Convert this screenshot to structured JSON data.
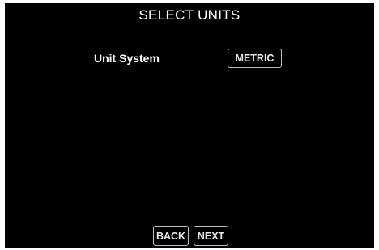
{
  "header": {
    "title": "SELECT UNITS"
  },
  "settings": {
    "unit_system_label": "Unit System",
    "unit_system_value": "METRIC"
  },
  "navigation": {
    "back_label": "BACK",
    "next_label": "NEXT"
  },
  "colors": {
    "background": "#000000",
    "text": "#ffffff",
    "button_border": "#bdbdbd"
  }
}
